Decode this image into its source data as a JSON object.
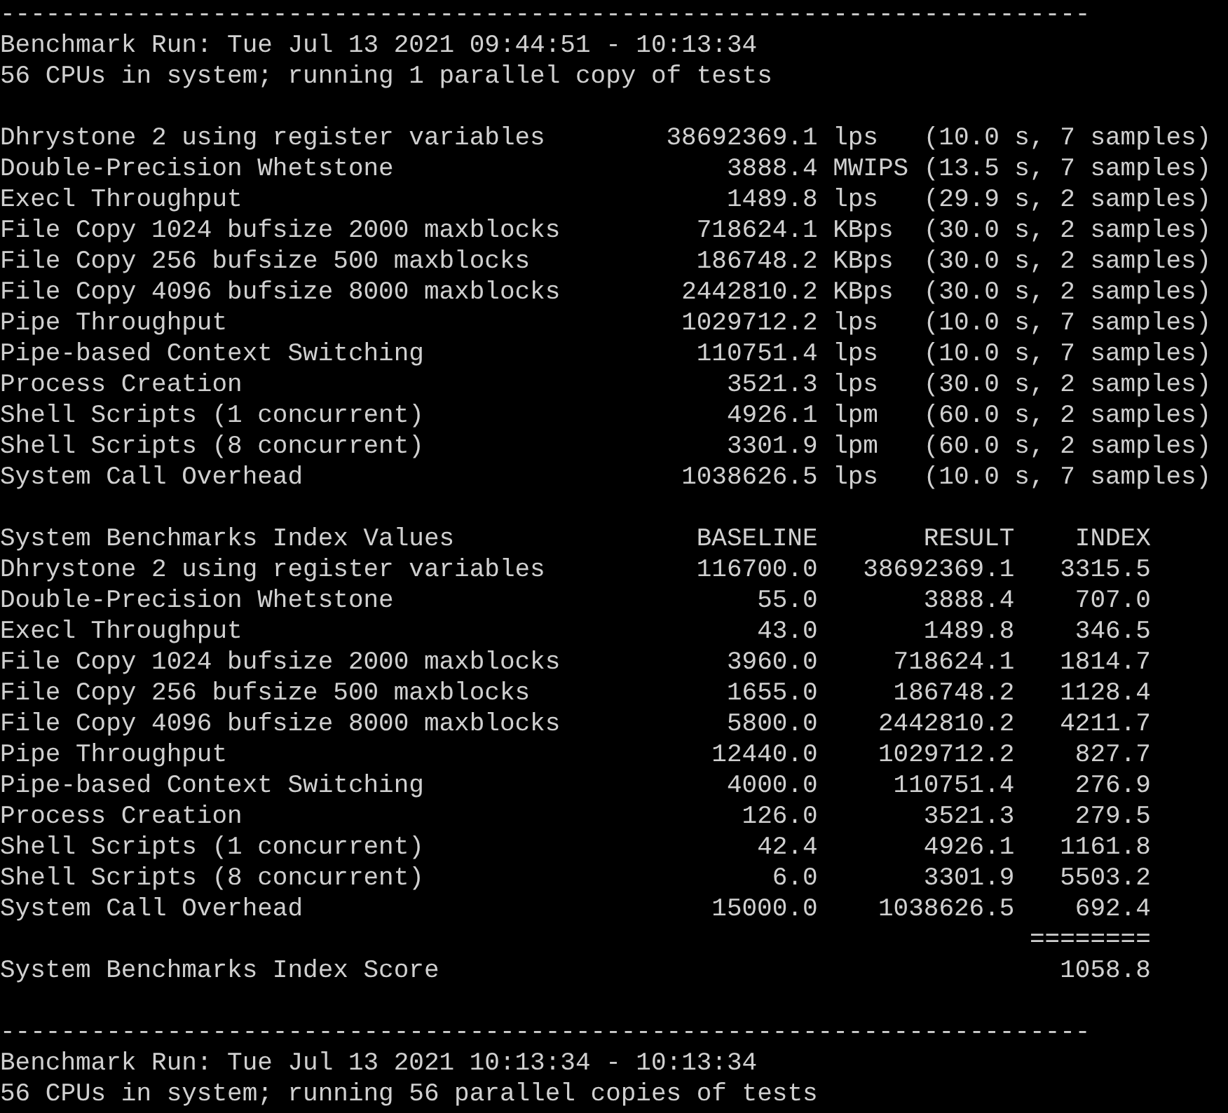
{
  "top_block": {
    "separator": "------------------------------------------------------------------------",
    "run_line": "Benchmark Run: Tue Jul 13 2021 09:44:51 - 10:13:34",
    "cpu_line": "56 CPUs in system; running 1 parallel copy of tests"
  },
  "results": [
    {
      "test": "Dhrystone 2 using register variables",
      "value": "38692369.1",
      "unit": "lps",
      "timing": "(10.0 s, 7 samples)"
    },
    {
      "test": "Double-Precision Whetstone",
      "value": "3888.4",
      "unit": "MWIPS",
      "timing": "(13.5 s, 7 samples)"
    },
    {
      "test": "Execl Throughput",
      "value": "1489.8",
      "unit": "lps",
      "timing": "(29.9 s, 2 samples)"
    },
    {
      "test": "File Copy 1024 bufsize 2000 maxblocks",
      "value": "718624.1",
      "unit": "KBps",
      "timing": "(30.0 s, 2 samples)"
    },
    {
      "test": "File Copy 256 bufsize 500 maxblocks",
      "value": "186748.2",
      "unit": "KBps",
      "timing": "(30.0 s, 2 samples)"
    },
    {
      "test": "File Copy 4096 bufsize 8000 maxblocks",
      "value": "2442810.2",
      "unit": "KBps",
      "timing": "(30.0 s, 2 samples)"
    },
    {
      "test": "Pipe Throughput",
      "value": "1029712.2",
      "unit": "lps",
      "timing": "(10.0 s, 7 samples)"
    },
    {
      "test": "Pipe-based Context Switching",
      "value": "110751.4",
      "unit": "lps",
      "timing": "(10.0 s, 7 samples)"
    },
    {
      "test": "Process Creation",
      "value": "3521.3",
      "unit": "lps",
      "timing": "(30.0 s, 2 samples)"
    },
    {
      "test": "Shell Scripts (1 concurrent)",
      "value": "4926.1",
      "unit": "lpm",
      "timing": "(60.0 s, 2 samples)"
    },
    {
      "test": "Shell Scripts (8 concurrent)",
      "value": "3301.9",
      "unit": "lpm",
      "timing": "(60.0 s, 2 samples)"
    },
    {
      "test": "System Call Overhead",
      "value": "1038626.5",
      "unit": "lps",
      "timing": "(10.0 s, 7 samples)"
    }
  ],
  "index_table": {
    "columns": [
      "System Benchmarks Index Values",
      "BASELINE",
      "RESULT",
      "INDEX"
    ],
    "rows": [
      [
        "Dhrystone 2 using register variables",
        "116700.0",
        "38692369.1",
        "3315.5"
      ],
      [
        "Double-Precision Whetstone",
        "55.0",
        "3888.4",
        "707.0"
      ],
      [
        "Execl Throughput",
        "43.0",
        "1489.8",
        "346.5"
      ],
      [
        "File Copy 1024 bufsize 2000 maxblocks",
        "3960.0",
        "718624.1",
        "1814.7"
      ],
      [
        "File Copy 256 bufsize 500 maxblocks",
        "1655.0",
        "186748.2",
        "1128.4"
      ],
      [
        "File Copy 4096 bufsize 8000 maxblocks",
        "5800.0",
        "2442810.2",
        "4211.7"
      ],
      [
        "Pipe Throughput",
        "12440.0",
        "1029712.2",
        "827.7"
      ],
      [
        "Pipe-based Context Switching",
        "4000.0",
        "110751.4",
        "276.9"
      ],
      [
        "Process Creation",
        "126.0",
        "3521.3",
        "279.5"
      ],
      [
        "Shell Scripts (1 concurrent)",
        "42.4",
        "4926.1",
        "1161.8"
      ],
      [
        "Shell Scripts (8 concurrent)",
        "6.0",
        "3301.9",
        "5503.2"
      ],
      [
        "System Call Overhead",
        "15000.0",
        "1038626.5",
        "692.4"
      ]
    ],
    "rule": "========",
    "score_label": "System Benchmarks Index Score",
    "score": "1058.8"
  },
  "bottom_block": {
    "separator": "------------------------------------------------------------------------",
    "run_line": "Benchmark Run: Tue Jul 13 2021 10:13:34 - 10:13:34",
    "cpu_line": "56 CPUs in system; running 56 parallel copies of tests"
  }
}
